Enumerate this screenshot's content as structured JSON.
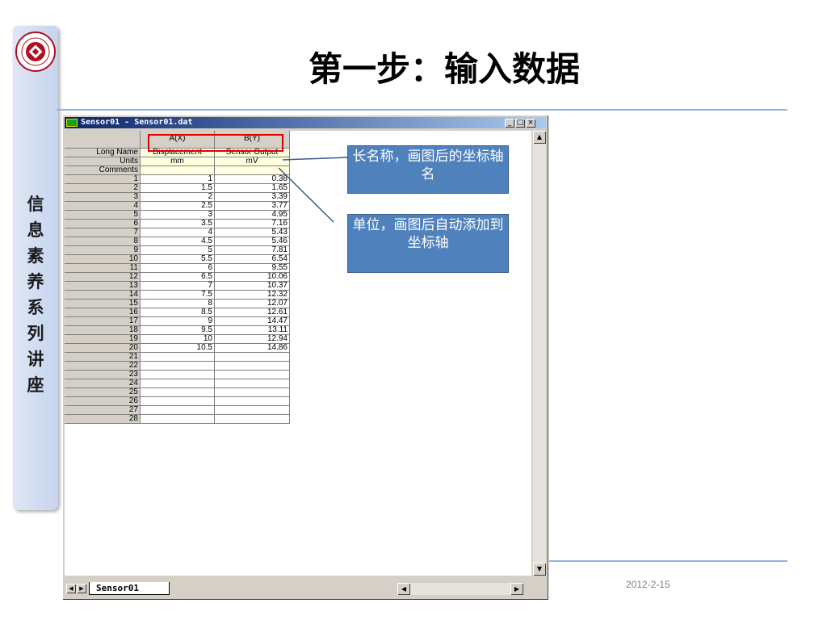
{
  "slide": {
    "title": "第一步：输入数据",
    "vertical_title": [
      "信",
      "息",
      "素",
      "养",
      "系",
      "列",
      "讲",
      "座"
    ],
    "date": "2012-2-15",
    "logo_icon": "university-seal-icon",
    "accent_color": "#8fb4e3"
  },
  "window": {
    "title": "Sensor01 - Sensor01.dat",
    "minimize_label": "_",
    "maximize_label": "□",
    "close_label": "×"
  },
  "sheet": {
    "col_a_header": "A(X)",
    "col_b_header": "B(Y)",
    "meta_rows": [
      {
        "label": "Long Name",
        "a": "Displacement",
        "b": "Sensor Output"
      },
      {
        "label": "Units",
        "a": "mm",
        "b": "mV"
      },
      {
        "label": "Comments",
        "a": "",
        "b": ""
      }
    ],
    "rows": [
      {
        "n": "1",
        "a": "1",
        "b": "0.38"
      },
      {
        "n": "2",
        "a": "1.5",
        "b": "1.65"
      },
      {
        "n": "3",
        "a": "2",
        "b": "3.39"
      },
      {
        "n": "4",
        "a": "2.5",
        "b": "3.77"
      },
      {
        "n": "5",
        "a": "3",
        "b": "4.95"
      },
      {
        "n": "6",
        "a": "3.5",
        "b": "7.16"
      },
      {
        "n": "7",
        "a": "4",
        "b": "5.43"
      },
      {
        "n": "8",
        "a": "4.5",
        "b": "5.46"
      },
      {
        "n": "9",
        "a": "5",
        "b": "7.81"
      },
      {
        "n": "10",
        "a": "5.5",
        "b": "6.54"
      },
      {
        "n": "11",
        "a": "6",
        "b": "9.55"
      },
      {
        "n": "12",
        "a": "6.5",
        "b": "10.06"
      },
      {
        "n": "13",
        "a": "7",
        "b": "10.37"
      },
      {
        "n": "14",
        "a": "7.5",
        "b": "12.32"
      },
      {
        "n": "15",
        "a": "8",
        "b": "12.07"
      },
      {
        "n": "16",
        "a": "8.5",
        "b": "12.61"
      },
      {
        "n": "17",
        "a": "9",
        "b": "14.47"
      },
      {
        "n": "18",
        "a": "9.5",
        "b": "13.11"
      },
      {
        "n": "19",
        "a": "10",
        "b": "12.94"
      },
      {
        "n": "20",
        "a": "10.5",
        "b": "14.86"
      },
      {
        "n": "21",
        "a": "",
        "b": ""
      },
      {
        "n": "22",
        "a": "",
        "b": ""
      },
      {
        "n": "23",
        "a": "",
        "b": ""
      },
      {
        "n": "24",
        "a": "",
        "b": ""
      },
      {
        "n": "25",
        "a": "",
        "b": ""
      },
      {
        "n": "26",
        "a": "",
        "b": ""
      },
      {
        "n": "27",
        "a": "",
        "b": ""
      },
      {
        "n": "28",
        "a": "",
        "b": ""
      }
    ],
    "tab_label": "Sensor01"
  },
  "callouts": {
    "long_name": "长名称，画图后的坐标轴名",
    "units": "单位，画图后自动添加到坐标轴"
  }
}
